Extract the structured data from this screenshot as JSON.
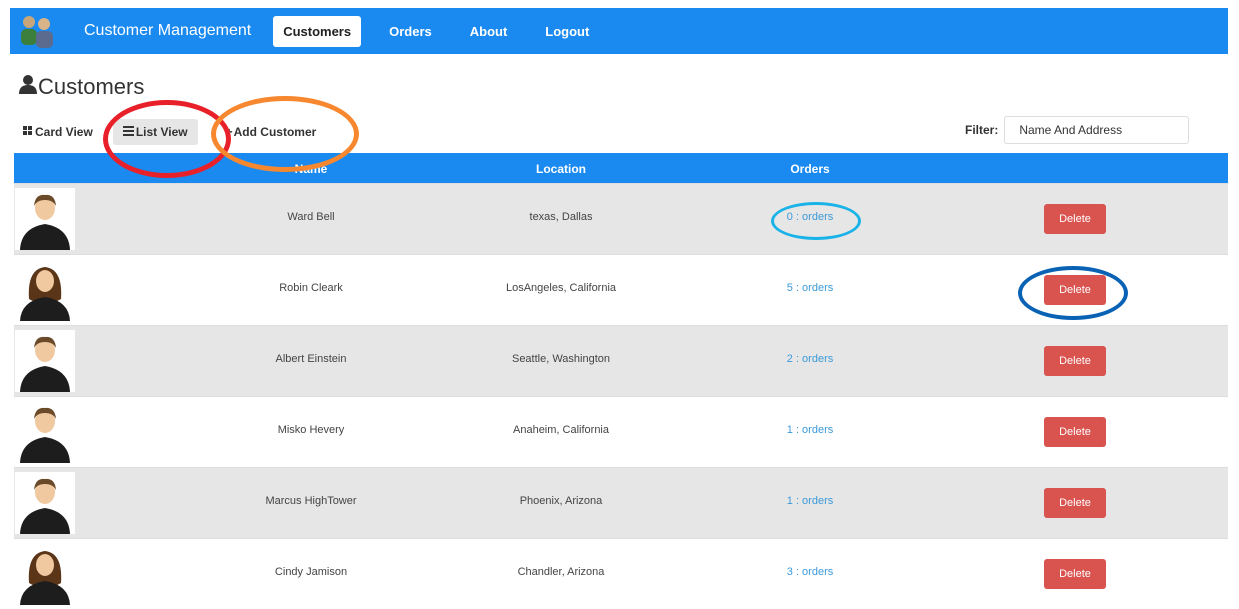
{
  "nav": {
    "brand": "Customer Management",
    "links": [
      {
        "label": "Customers",
        "active": true
      },
      {
        "label": "Orders",
        "active": false
      },
      {
        "label": "About",
        "active": false
      },
      {
        "label": "Logout",
        "active": false
      }
    ]
  },
  "page": {
    "title": "Customers",
    "title_icon": "user-icon"
  },
  "toolbar": {
    "card_view": "Card View",
    "list_view": "List View",
    "add_customer": "Add Customer",
    "filter_label": "Filter:",
    "filter_value": "Name And Address"
  },
  "table": {
    "columns": [
      "Name",
      "Location",
      "Orders"
    ],
    "rows": [
      {
        "name": "Ward Bell",
        "location": "texas, Dallas",
        "orders": "0 : orders",
        "gender": "male",
        "action": "Delete"
      },
      {
        "name": "Robin Cleark",
        "location": "LosAngeles, California",
        "orders": "5 : orders",
        "gender": "female",
        "action": "Delete"
      },
      {
        "name": "Albert Einstein",
        "location": "Seattle, Washington",
        "orders": "2 : orders",
        "gender": "male",
        "action": "Delete"
      },
      {
        "name": "Misko Hevery",
        "location": "Anaheim, California",
        "orders": "1 : orders",
        "gender": "male",
        "action": "Delete"
      },
      {
        "name": "Marcus HighTower",
        "location": "Phoenix, Arizona",
        "orders": "1 : orders",
        "gender": "male",
        "action": "Delete"
      },
      {
        "name": "Cindy Jamison",
        "location": "Chandler, Arizona",
        "orders": "3 : orders",
        "gender": "female",
        "action": "Delete"
      }
    ]
  },
  "colors": {
    "navbar": "#1a8af0",
    "delete": "#d9534f",
    "link": "#3b9ad9",
    "mark_list_view": "#e8202a",
    "mark_add_customer": "#f7882f",
    "mark_orders": "#1ab3e8",
    "mark_delete": "#0a62b5"
  }
}
